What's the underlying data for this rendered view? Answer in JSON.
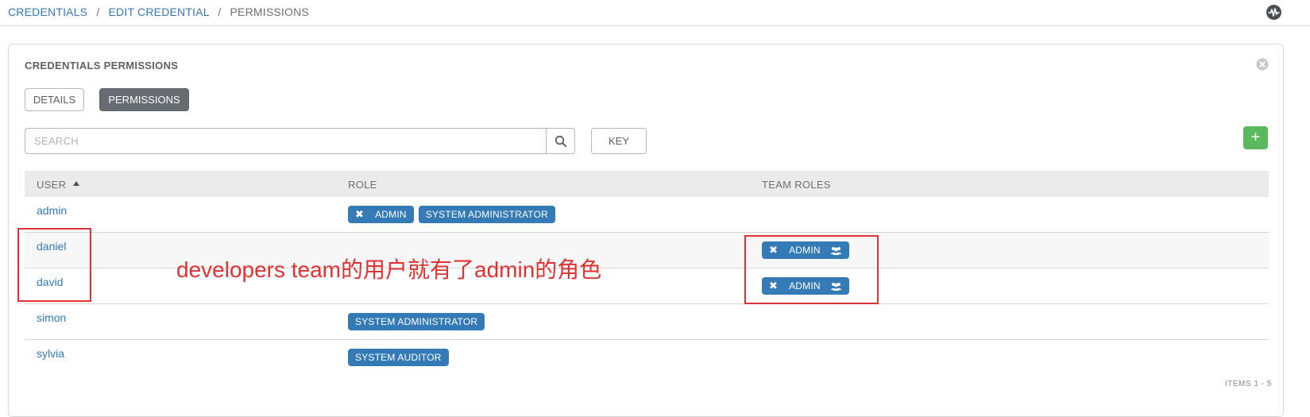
{
  "breadcrumb": {
    "items": [
      "CREDENTIALS",
      "EDIT CREDENTIAL"
    ],
    "separator": "/",
    "current": "PERMISSIONS"
  },
  "panel": {
    "title": "CREDENTIALS PERMISSIONS",
    "tabs": {
      "details": "DETAILS",
      "permissions": "PERMISSIONS"
    }
  },
  "search": {
    "placeholder": "SEARCH",
    "value": ""
  },
  "toolbar": {
    "key_label": "KEY",
    "add_label": "+"
  },
  "table": {
    "headers": {
      "user": "USER",
      "role": "ROLE",
      "team_roles": "TEAM ROLES"
    },
    "rows": [
      {
        "user": "admin",
        "roles": [
          {
            "label": "ADMIN",
            "removable": true
          },
          {
            "label": "SYSTEM ADMINISTRATOR",
            "removable": false
          }
        ],
        "team_roles": []
      },
      {
        "user": "daniel",
        "roles": [],
        "team_roles": [
          {
            "label": "ADMIN",
            "removable": true,
            "icon": "users-icon"
          }
        ]
      },
      {
        "user": "david",
        "roles": [],
        "team_roles": [
          {
            "label": "ADMIN",
            "removable": true,
            "icon": "users-icon"
          }
        ]
      },
      {
        "user": "simon",
        "roles": [
          {
            "label": "SYSTEM ADMINISTRATOR",
            "removable": false
          }
        ],
        "team_roles": []
      },
      {
        "user": "sylvia",
        "roles": [
          {
            "label": "SYSTEM AUDITOR",
            "removable": false
          }
        ],
        "team_roles": []
      }
    ]
  },
  "footer": {
    "items_count": "ITEMS 1 - 5"
  },
  "annotation": {
    "text": "developers team的用户就有了admin的角色"
  },
  "colors": {
    "link": "#337ab7",
    "chip": "#337ab7",
    "add": "#5cb85c",
    "annotation": "#e03232",
    "tab_active": "#676b72"
  },
  "icons": {
    "activity": "activity-icon",
    "close": "close-icon",
    "search": "search-icon",
    "sort": "sort-asc-icon",
    "team": "users-icon",
    "remove": "remove-x-icon"
  }
}
